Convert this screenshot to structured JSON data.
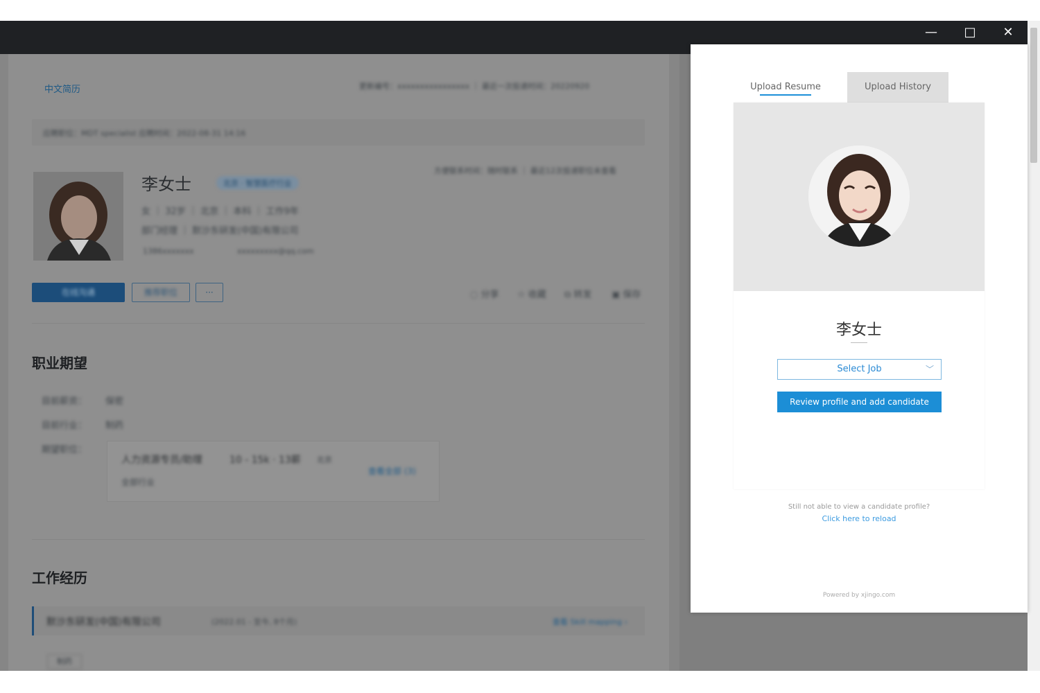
{
  "window_controls": {
    "minimize": "—",
    "maximize": "□",
    "close": "✕"
  },
  "background": {
    "lang_link": "中文简历",
    "resume_meta": "更新编号：xxxxxxxxxxxxxxxx ｜ 最近一次投递时间：20220920",
    "applied_line": "应聘职位：MDT specialist 应聘时间：2022-08-31 14:16",
    "right_meta": "方便联系时间：随时联系 ｜ 最近12次投递职位未查看",
    "name": "李女士",
    "tag": "北京 · 智慧医疗行业",
    "basics": "女 ｜ 32岁 ｜ 北京 ｜ 本科 ｜ 工作9年",
    "current_job": "部门经理 ｜ 默沙东研发(中国)有限公司",
    "phone": "1386xxxxxxx",
    "email": "xxxxxxxxx@qq.com",
    "btn_chat": "在线沟通",
    "btn_recommend": "推荐职位",
    "btn_more": "···",
    "actions": [
      "分享",
      "收藏",
      "转发",
      "保存"
    ],
    "section_expect": "职业期望",
    "expect_rows": [
      {
        "label": "目前薪资：",
        "value": "保密"
      },
      {
        "label": "目前行业：",
        "value": "制药"
      }
    ],
    "expect_job_label": "期望职位：",
    "expect_job_title": "人力资源专员/助理",
    "expect_job_salary": "10 - 15k · 13薪",
    "expect_job_city": "北京",
    "expect_job_industry": "全部行业",
    "expect_view_all": "查看全部 (3)",
    "section_work": "工作经历",
    "work_company": "默沙东研发(中国)有限公司",
    "work_period": "(2022.01 - 至今, 8个月)",
    "work_link": "查看 Skill mapping ›",
    "work_tag": "制药"
  },
  "panel": {
    "tabs": [
      "Upload Resume",
      "Upload History"
    ],
    "candidate_name": "李女士",
    "select_job_placeholder": "Select Job",
    "review_button": "Review profile and add candidate",
    "reload_note": "Still not able to view a candidate profile?",
    "reload_link": "Click here to reload",
    "powered_by": "Powered by xjingo.com"
  }
}
